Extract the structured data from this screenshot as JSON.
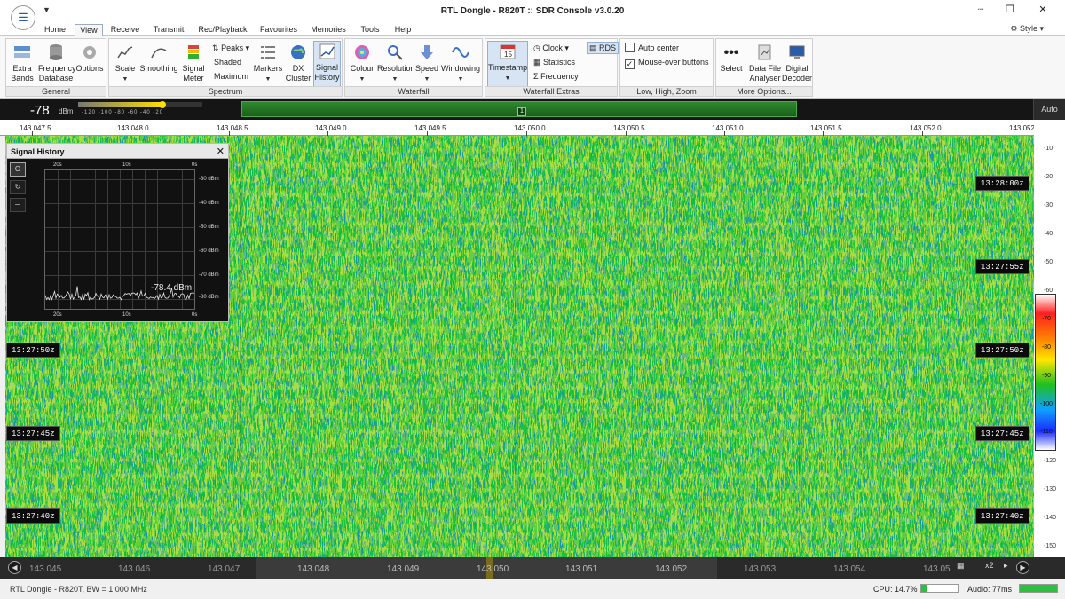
{
  "window": {
    "title": "RTL Dongle - R820T :: SDR Console v3.0.20",
    "minimize": "┈",
    "maximize": "❐",
    "close": "✕"
  },
  "menu": {
    "tabs": [
      "Home",
      "View",
      "Receive",
      "Transmit",
      "Rec/Playback",
      "Favourites",
      "Memories",
      "Tools",
      "Help"
    ],
    "active_tab": "View",
    "style_label": "Style"
  },
  "ribbon": {
    "general": {
      "label": "General",
      "buttons": [
        "Extra Bands",
        "Frequency Database",
        "Options"
      ]
    },
    "spectrum": {
      "label": "Spectrum",
      "buttons": [
        "Scale",
        "Smoothing",
        "Signal Meter",
        "Markers",
        "DX Cluster",
        "Signal History"
      ],
      "peaks": "Peaks",
      "shaded": "Shaded",
      "maximum": "Maximum"
    },
    "waterfall": {
      "label": "Waterfall",
      "buttons": [
        "Colour",
        "Resolution",
        "Speed",
        "Windowing"
      ]
    },
    "waterfall_extras": {
      "label": "Waterfall Extras",
      "timestamp": "Timestamp",
      "clock": "Clock",
      "statistics": "Statistics",
      "frequency": "Frequency",
      "rds": "RDS"
    },
    "zoom": {
      "label": "Low, High, Zoom",
      "auto_center": "Auto center",
      "mouse_over": "Mouse-over buttons",
      "auto_center_checked": false,
      "mouse_over_checked": true
    },
    "more": {
      "label": "More Options...",
      "buttons": [
        "Select",
        "Data File Analyser",
        "Digital Decoder"
      ]
    }
  },
  "signal": {
    "value": "-78",
    "unit": "dBm",
    "scale": "-120  -100  -80  -60  -40  -20",
    "level_fraction": 0.68,
    "marker": "1",
    "auto": "Auto"
  },
  "freq_axis": [
    "143.047.5",
    "143.048.0",
    "143.048.5",
    "143.049.0",
    "143.049.5",
    "143.050.0",
    "143.050.5",
    "143.051.0",
    "143.051.5",
    "143.052.0",
    "143.052"
  ],
  "right_scale": [
    "-10",
    "-20",
    "-30",
    "-40",
    "-50",
    "-60",
    "-70",
    "-80",
    "-90",
    "-100",
    "-110",
    "-120",
    "-130",
    "-140",
    "-150"
  ],
  "colorbar_labels": [
    "-70",
    "-80",
    "-90",
    "-100",
    "-110"
  ],
  "timestamps": {
    "left": [
      "13:27:50z",
      "13:27:45z",
      "13:27:40z"
    ],
    "right": [
      "13:28:00z",
      "13:27:55z",
      "13:27:50z",
      "13:27:45z",
      "13:27:40z"
    ]
  },
  "signal_history": {
    "title": "Signal History",
    "close": "✕",
    "y_labels": [
      "-30 dBm",
      "-40 dBm",
      "-50 dBm",
      "-60 dBm",
      "-70 dBm",
      "-80 dBm"
    ],
    "x_labels": [
      "20s",
      "10s",
      "0s"
    ],
    "reading": "-78.4 dBm",
    "tools": [
      "O",
      "↻",
      "─"
    ]
  },
  "bottom_axis": {
    "labels": [
      "143.045",
      "143.046",
      "143.047",
      "143.048",
      "143.049",
      "143.050",
      "143.051",
      "143.052",
      "143.053",
      "143.054",
      "143.05"
    ],
    "zoom": "x2",
    "left_nav": "◀",
    "right_nav": "▶"
  },
  "status": {
    "left": "RTL Dongle - R820T, BW = 1.000 MHz",
    "cpu": "CPU: 14.7%",
    "cpu_fraction": 0.147,
    "audio": "Audio: 77ms",
    "audio_fraction": 1.0
  },
  "colors": {
    "waterfall": "#1ec23c",
    "accent": "#2a5caa"
  }
}
